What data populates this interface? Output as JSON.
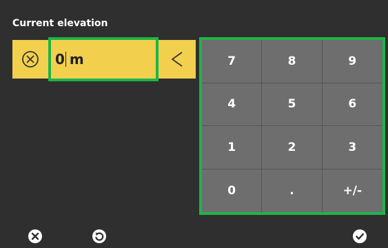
{
  "title": "Current elevation",
  "input": {
    "value": "0",
    "unit": "m"
  },
  "icons": {
    "clear": "clear-circle-icon",
    "backspace": "chevron-left-icon",
    "cancel": "cancel-icon",
    "reset": "reset-icon",
    "confirm": "check-icon"
  },
  "keypad": {
    "keys": [
      "7",
      "8",
      "9",
      "4",
      "5",
      "6",
      "1",
      "2",
      "3",
      "0",
      ".",
      "+/-"
    ]
  },
  "colors": {
    "background": "#2f2f2f",
    "input_bg": "#f2d04e",
    "highlight": "#1db548",
    "key_bg": "#6e6e6e"
  }
}
